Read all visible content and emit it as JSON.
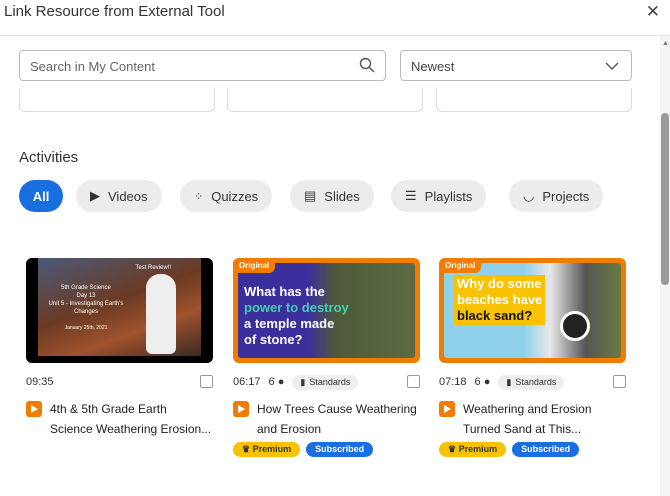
{
  "window": {
    "title": "Link Resource from External Tool"
  },
  "search": {
    "placeholder": "Search in My Content"
  },
  "sort": {
    "selected": "Newest"
  },
  "section": {
    "heading": "Activities"
  },
  "filters": [
    {
      "label": "All"
    },
    {
      "label": "Videos"
    },
    {
      "label": "Quizzes"
    },
    {
      "label": "Slides"
    },
    {
      "label": "Playlists"
    },
    {
      "label": "Projects"
    }
  ],
  "cards": [
    {
      "duration": "09:35",
      "title1": "4th & 5th Grade Earth",
      "title2": "Science Weathering Erosion...",
      "thumb_text": [
        "Test Review!!",
        "5th Grade Science",
        "Day 13",
        "Unit 5 - Investigating Earth's",
        "Changes",
        "January 25th, 2021"
      ]
    },
    {
      "duration": "06:17",
      "count": "6",
      "standards": "Standards",
      "title1": "How Trees Cause Weathering",
      "title2": "and Erosion",
      "original": "Original",
      "thumb_text": [
        "What has the",
        "power to destroy",
        "a temple made",
        "of stone?"
      ],
      "premium": "Premium",
      "subscribed": "Subscribed"
    },
    {
      "duration": "07:18",
      "count": "6",
      "standards": "Standards",
      "title1": "Weathering and Erosion",
      "title2": "Turned Sand at This...",
      "original": "Original",
      "thumb_text": [
        "Why do some",
        "beaches have",
        "black sand?"
      ],
      "premium": "Premium",
      "subscribed": "Subscribed"
    }
  ],
  "colors": {
    "accent": "#1a6fe0",
    "orange": "#f07c00",
    "premium": "#f9c200"
  }
}
